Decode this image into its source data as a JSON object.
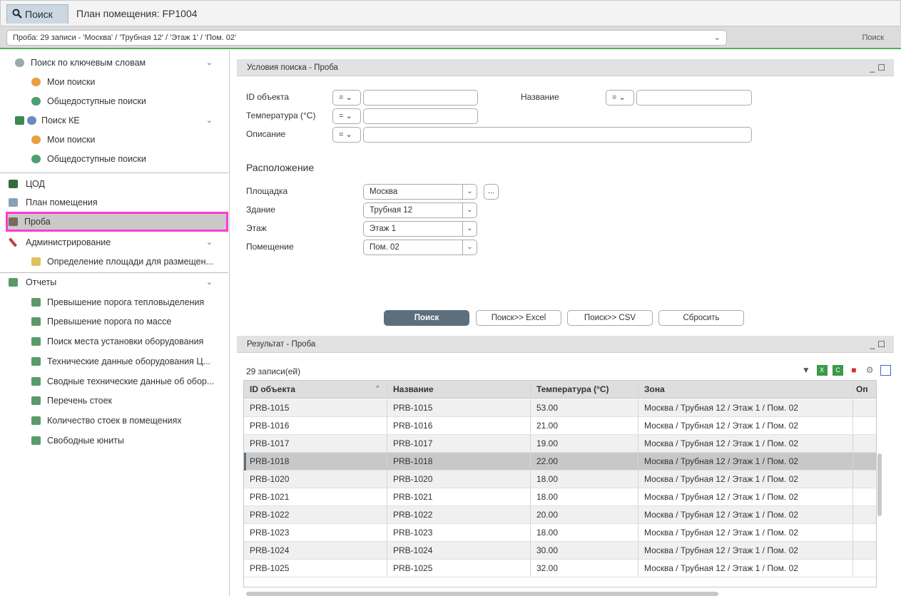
{
  "tabs": {
    "search": "Поиск",
    "plan": "План помещения: FP1004"
  },
  "query_bar": {
    "value": "Проба: 29 записи - 'Москва' / 'Трубная 12' / 'Этаж 1' / 'Пом. 02'",
    "search_label": "Поиск"
  },
  "sidebar": {
    "items": [
      {
        "label": "Поиск по ключевым словам",
        "icon": "keyword-search-icon"
      },
      {
        "label": "Мои поиски",
        "icon": "my-searches-icon"
      },
      {
        "label": "Общедоступные поиски",
        "icon": "public-searches-icon"
      },
      {
        "label": "Поиск КЕ",
        "icon": "ci-search-icon"
      },
      {
        "label": "Мои поиски",
        "icon": "my-searches-icon"
      },
      {
        "label": "Общедоступные поиски",
        "icon": "public-searches-icon"
      },
      {
        "label": "ЦОД",
        "icon": "datacenter-icon"
      },
      {
        "label": "План помещения",
        "icon": "floor-plan-icon"
      },
      {
        "label": "Проба",
        "icon": "probe-icon"
      },
      {
        "label": "Администрирование",
        "icon": "admin-icon"
      },
      {
        "label": "Определение площади для размещен...",
        "icon": "area-definition-icon"
      },
      {
        "label": "Отчеты",
        "icon": "reports-icon"
      },
      {
        "label": "Превышение порога тепловыделения",
        "icon": "report-icon"
      },
      {
        "label": "Превышение порога по массе",
        "icon": "report-icon"
      },
      {
        "label": "Поиск места установки оборудования",
        "icon": "report-icon"
      },
      {
        "label": "Технические данные оборудования Ц...",
        "icon": "report-icon"
      },
      {
        "label": "Сводные технические данные об обор...",
        "icon": "report-icon"
      },
      {
        "label": "Перечень стоек",
        "icon": "report-icon"
      },
      {
        "label": "Количество стоек в помещениях",
        "icon": "report-icon"
      },
      {
        "label": "Свободные юниты",
        "icon": "report-icon"
      }
    ]
  },
  "criteria": {
    "title": "Условия поиска - Проба",
    "id_label": "ID объекта",
    "name_label": "Название",
    "temp_label": "Температура (°C)",
    "desc_label": "Описание",
    "op": "=",
    "location_heading": "Расположение",
    "site_label": "Площадка",
    "site_value": "Москва",
    "building_label": "Здание",
    "building_value": "Трубная 12",
    "floor_label": "Этаж",
    "floor_value": "Этаж 1",
    "room_label": "Помещение",
    "room_value": "Пом. 02",
    "dots": "...",
    "buttons": {
      "search": "Поиск",
      "excel": "Поиск>> Excel",
      "csv": "Поиск>> CSV",
      "reset": "Сбросить"
    }
  },
  "results": {
    "title": "Результат - Проба",
    "count": "29 записи(ей)",
    "columns": [
      "ID объекта",
      "Название",
      "Температура (°C)",
      "Зона",
      "Оп"
    ],
    "rows": [
      [
        "PRB-1015",
        "PRB-1015",
        "53.00",
        "Москва / Трубная 12 / Этаж 1 / Пом. 02"
      ],
      [
        "PRB-1016",
        "PRB-1016",
        "21.00",
        "Москва / Трубная 12 / Этаж 1 / Пом. 02"
      ],
      [
        "PRB-1017",
        "PRB-1017",
        "19.00",
        "Москва / Трубная 12 / Этаж 1 / Пом. 02"
      ],
      [
        "PRB-1018",
        "PRB-1018",
        "22.00",
        "Москва / Трубная 12 / Этаж 1 / Пом. 02"
      ],
      [
        "PRB-1020",
        "PRB-1020",
        "18.00",
        "Москва / Трубная 12 / Этаж 1 / Пом. 02"
      ],
      [
        "PRB-1021",
        "PRB-1021",
        "18.00",
        "Москва / Трубная 12 / Этаж 1 / Пом. 02"
      ],
      [
        "PRB-1022",
        "PRB-1022",
        "20.00",
        "Москва / Трубная 12 / Этаж 1 / Пом. 02"
      ],
      [
        "PRB-1023",
        "PRB-1023",
        "18.00",
        "Москва / Трубная 12 / Этаж 1 / Пом. 02"
      ],
      [
        "PRB-1024",
        "PRB-1024",
        "30.00",
        "Москва / Трубная 12 / Этаж 1 / Пом. 02"
      ],
      [
        "PRB-1025",
        "PRB-1025",
        "32.00",
        "Москва / Трубная 12 / Этаж 1 / Пом. 02"
      ]
    ]
  },
  "colors": {
    "accent_green": "#4caf50",
    "selection_outline": "#ff3ad2",
    "primary_button": "#5c6f7e"
  }
}
